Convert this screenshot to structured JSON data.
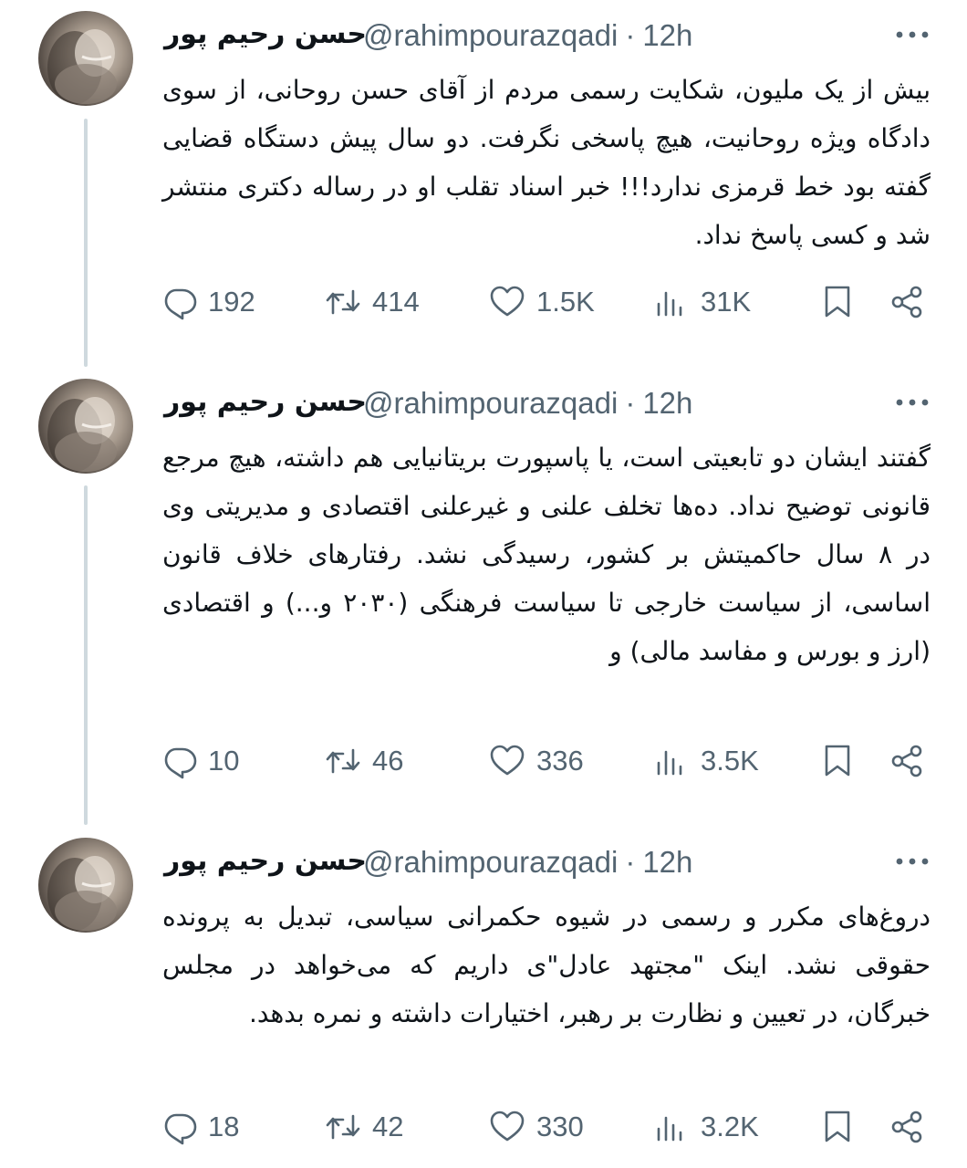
{
  "tweets": [
    {
      "author_name": "حسن رحیم پور",
      "handle": "@rahimpourazqadi",
      "separator": "·",
      "time": "12h",
      "text": "بیش از یک ملیون، شکایت رسمی مردم از آقای حسن روحانی، از سوی دادگاه ویژه روحانیت، هیچ پاسخی نگرفت. دو سال پیش دستگاه قضایی گفته بود خط قرمزی ندارد!!! خبر اسناد تقلب او در رساله دکتری منتشر شد و کسی پاسخ نداد.",
      "replies": "192",
      "reposts": "414",
      "likes": "1.5K",
      "views": "31K"
    },
    {
      "author_name": "حسن رحیم پور",
      "handle": "@rahimpourazqadi",
      "separator": "·",
      "time": "12h",
      "text": "گفتند ایشان دو تابعیتی است، یا پاسپورت بریتانیایی هم داشته، هیچ مرجع قانونی توضیح نداد. ده‌ها تخلف علنی و غیرعلنی اقتصادی و مدیریتی وی در ۸ سال حاکمیتش بر کشور، رسیدگی نشد. رفتارهای خلاف قانون اساسی، از سیاست خارجی تا سیاست فرهنگی (۲۰۳۰ و...) و اقتصادی (ارز و بورس و مفاسد مالی) و",
      "replies": "10",
      "reposts": "46",
      "likes": "336",
      "views": "3.5K"
    },
    {
      "author_name": "حسن رحیم پور",
      "handle": "@rahimpourazqadi",
      "separator": "·",
      "time": "12h",
      "text": "دروغ‌های مکرر و رسمی در شیوه حکمرانی سیاسی، تبدیل به پرونده حقوقی نشد. اینک \"مجتهد عادل\"ی داریم که می‌خواهد در مجلس خبرگان، در تعیین و نظارت بر رهبر، اختیارات داشته و نمره بدهد.",
      "replies": "18",
      "reposts": "42",
      "likes": "330",
      "views": "3.2K"
    }
  ],
  "icons": {
    "more": "more-dots-icon",
    "reply": "reply-icon",
    "repost": "repost-icon",
    "like": "heart-icon",
    "views": "views-chart-icon",
    "bookmark": "bookmark-icon",
    "share": "share-icon"
  },
  "colors": {
    "text": "#0f1419",
    "secondary": "#536471",
    "thread_line": "#cfd9de"
  }
}
